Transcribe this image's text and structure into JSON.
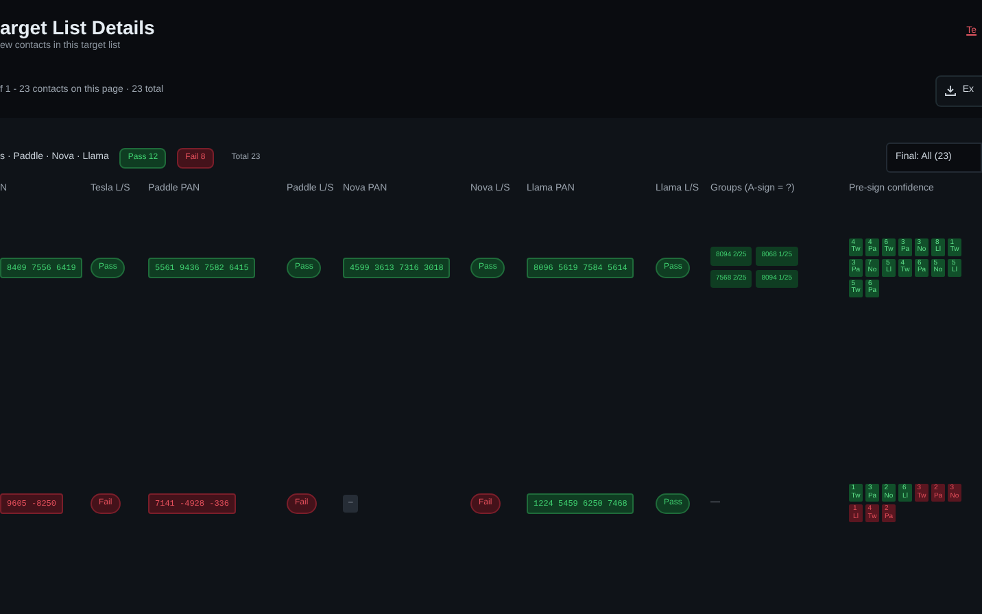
{
  "header": {
    "title": "arget List Details",
    "subtitle": "ew contacts in this target list",
    "count_text": "f 1 - 23 contacts on this page · 23 total",
    "corner_link": "Te",
    "export_button": "Ex"
  },
  "filters": {
    "breadcrumb": "s · Paddle · Nova · Llama",
    "badges": [
      {
        "label": "Pass 12",
        "kind": "pass"
      },
      {
        "label": "Fail 8",
        "kind": "fail"
      },
      {
        "label": "Total 23",
        "kind": "plain"
      }
    ],
    "select": {
      "value": "Final: All (23)"
    }
  },
  "table": {
    "columns": [
      "N",
      "Tesla L/S",
      "Paddle PAN",
      "Paddle L/S",
      "Nova PAN",
      "Nova L/S",
      "Llama PAN",
      "Llama L/S",
      "Groups (A-sign = ?)",
      "Pre-sign confidence"
    ],
    "rows": [
      {
        "cells": [
          {
            "kind": "pan",
            "text": "8409 7556 6419",
            "passed": true
          },
          {
            "kind": "status",
            "text": "Pass",
            "passed": true
          },
          {
            "kind": "pan",
            "text": "5561 9436 7582 6415",
            "passed": true
          },
          {
            "kind": "status",
            "text": "Pass",
            "passed": true
          },
          {
            "kind": "pan",
            "text": "4599 3613 7316 3018",
            "passed": true
          },
          {
            "kind": "status",
            "text": "Pass",
            "passed": true
          },
          {
            "kind": "pan",
            "text": "8096 5619 7584 5614",
            "passed": true
          },
          {
            "kind": "status",
            "text": "Pass",
            "passed": true
          },
          {
            "kind": "groups",
            "items": [
              "8094 2/25",
              "8068 1/25",
              "7568 2/25",
              "8094 1/25"
            ]
          },
          {
            "kind": "confidence",
            "items": [
              {
                "value": "4",
                "label": "Tw",
                "passed": true
              },
              {
                "value": "4",
                "label": "Pa",
                "passed": true
              },
              {
                "value": "6",
                "label": "Tw",
                "passed": true
              },
              {
                "value": "3",
                "label": "Pa",
                "passed": true
              },
              {
                "value": "3",
                "label": "No",
                "passed": true
              },
              {
                "value": "8",
                "label": "Ll",
                "passed": true
              },
              {
                "value": "1",
                "label": "Tw",
                "passed": true
              },
              {
                "value": "3",
                "label": "Pa",
                "passed": true
              },
              {
                "value": "7",
                "label": "No",
                "passed": true
              },
              {
                "value": "5",
                "label": "Ll",
                "passed": true
              },
              {
                "value": "4",
                "label": "Tw",
                "passed": true
              },
              {
                "value": "6",
                "label": "Pa",
                "passed": true
              },
              {
                "value": "5",
                "label": "No",
                "passed": true
              },
              {
                "value": "5",
                "label": "Ll",
                "passed": true
              },
              {
                "value": "5",
                "label": "Tw",
                "passed": true
              },
              {
                "value": "6",
                "label": "Pa",
                "passed": true
              }
            ]
          }
        ]
      },
      {
        "cells": [
          {
            "kind": "pan",
            "text": "9605 -8250",
            "passed": false
          },
          {
            "kind": "status",
            "text": "Fail",
            "passed": false
          },
          {
            "kind": "pan",
            "text": "7141 -4928 -336",
            "passed": false
          },
          {
            "kind": "status",
            "text": "Fail",
            "passed": false
          },
          {
            "kind": "dash",
            "text": "–"
          },
          {
            "kind": "status",
            "text": "Fail",
            "passed": false
          },
          {
            "kind": "pan",
            "text": "1224 5459 6250 7468",
            "passed": true
          },
          {
            "kind": "status",
            "text": "Pass",
            "passed": true
          },
          {
            "kind": "dash",
            "text": "—"
          },
          {
            "kind": "confidence",
            "items": [
              {
                "value": "1",
                "label": "Tw",
                "passed": true
              },
              {
                "value": "3",
                "label": "Pa",
                "passed": true
              },
              {
                "value": "2",
                "label": "No",
                "passed": true
              },
              {
                "value": "6",
                "label": "Ll",
                "passed": true
              },
              {
                "value": "3",
                "label": "Tw",
                "passed": false
              },
              {
                "value": "2",
                "label": "Pa",
                "passed": false
              },
              {
                "value": "3",
                "label": "No",
                "passed": false
              },
              {
                "value": "1",
                "label": "Ll",
                "passed": false
              },
              {
                "value": "4",
                "label": "Tw",
                "passed": false
              },
              {
                "value": "2",
                "label": "Pa",
                "passed": false
              }
            ]
          }
        ]
      }
    ]
  }
}
